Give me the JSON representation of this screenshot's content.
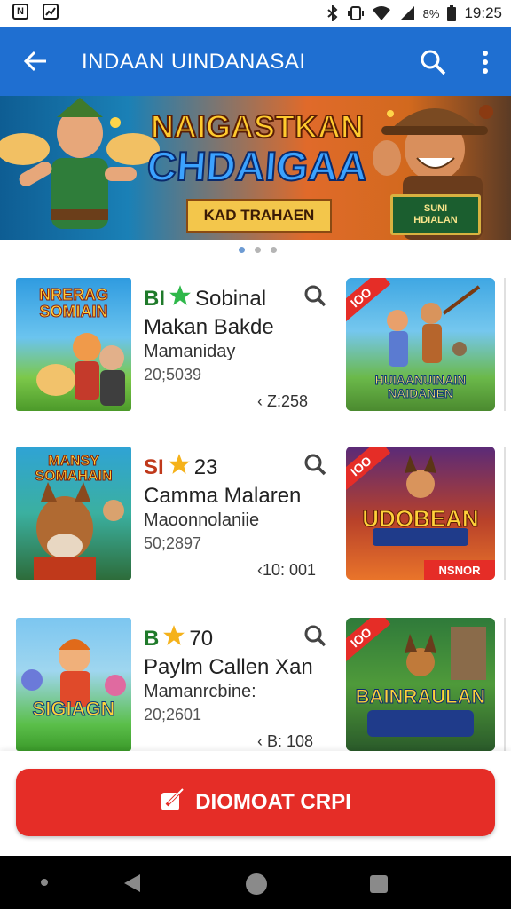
{
  "status_bar": {
    "left_icons": [
      "n-app-icon",
      "chart-app-icon"
    ],
    "battery_text": "8%",
    "time": "19:25"
  },
  "app_bar": {
    "title": "INDAAN UINDANASAI",
    "back_icon": "back-arrow-icon",
    "search_icon": "search-icon",
    "menu_icon": "more-vert-icon",
    "color": "#1f6fd1"
  },
  "banner": {
    "title_line1": "NAIGASTKAN",
    "title_line2": "CHDAIGAA",
    "ribbon": "KAD TRAHAEN",
    "sign_line1": "SUNI",
    "sign_line2": "HDIALAN"
  },
  "carousel_dots": {
    "count": 3,
    "active": 0
  },
  "games": [
    {
      "thumb_title": "NRERAG SOMIAIN",
      "code": "BI",
      "code_color": "#1f7a2a",
      "star_color": "#2fb84a",
      "rating_text": "Sobinal",
      "name": "Makan Bakde",
      "developer": "Mamaniday",
      "stats": "20;5039",
      "meta": "‹ Z:258",
      "side_tag": "IOO",
      "side_title": "HUIAANUINAIN NAIDANEN"
    },
    {
      "thumb_title": "MANSY SOMAHAIN",
      "code": "SI",
      "code_color": "#c0391b",
      "star_color": "#f5b21b",
      "rating_text": "23",
      "name": "Camma Malaren",
      "developer": "Maoonnolaniie",
      "stats": "50;2897",
      "meta": "‹10: 001",
      "side_tag": "IOO",
      "side_title": "UDOBEAN",
      "side_footer": "NSNOR"
    },
    {
      "thumb_title": "SIGIAGN",
      "code": "B",
      "code_color": "#1f7a2a",
      "star_color": "#f5b21b",
      "rating_text": "70",
      "name": "Paylm Callen Xan",
      "developer": "Mamanrcbine:",
      "stats": "20;2601",
      "meta": "‹ B: 108",
      "side_tag": "IOO",
      "side_title": "BAINRAULAN"
    }
  ],
  "cta": {
    "label": "DIOMOAT CRPI",
    "icon": "edit-square-icon",
    "color": "#e52d27"
  },
  "nav_bar": {
    "back": "nav-back-icon",
    "home": "nav-home-icon",
    "recents": "nav-recents-icon"
  }
}
